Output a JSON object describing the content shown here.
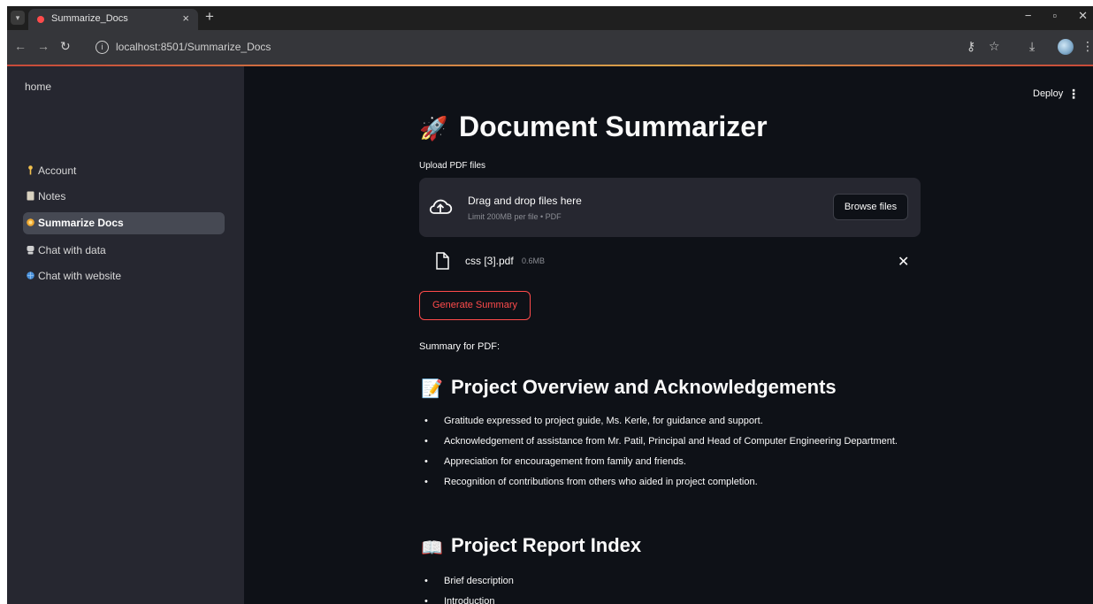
{
  "browser": {
    "tab_title": "Summarize_Docs",
    "url": "localhost:8501/Summarize_Docs"
  },
  "sidebar": {
    "home_label": "home",
    "items": [
      {
        "label": "Account",
        "icon": "key-icon",
        "color": "#f2c14e"
      },
      {
        "label": "Notes",
        "icon": "notebook-icon",
        "color": "#d9d2c0"
      },
      {
        "label": "Summarize Docs",
        "icon": "coin-icon",
        "color": "#f0a830"
      },
      {
        "label": "Chat with data",
        "icon": "chat-icon",
        "color": "#d0d0d0"
      },
      {
        "label": "Chat with website",
        "icon": "globe-icon",
        "color": "#4a90d9"
      }
    ],
    "active_index": 2
  },
  "header": {
    "deploy_label": "Deploy",
    "menu_icon": "⋮"
  },
  "main": {
    "title": "Document Summarizer",
    "title_icon": "🚀",
    "upload_label": "Upload PDF files",
    "dropzone": {
      "title": "Drag and drop files here",
      "limit": "Limit 200MB per file • PDF",
      "browse_label": "Browse files"
    },
    "file": {
      "name": "css [3].pdf",
      "size": "0.6MB"
    },
    "generate_label": "Generate Summary",
    "summary_label": "Summary for PDF:",
    "sections": [
      {
        "icon": "📝",
        "heading": "Project Overview and Acknowledgements",
        "bullets": [
          "Gratitude expressed to project guide, Ms. Kerle, for guidance and support.",
          "Acknowledgement of assistance from Mr. Patil, Principal and Head of Computer Engineering Department.",
          "Appreciation for encouragement from family and friends.",
          "Recognition of contributions from others who aided in project completion."
        ]
      },
      {
        "icon": "📖",
        "heading": "Project Report Index",
        "bullets": [
          "Brief description",
          "Introduction"
        ]
      }
    ]
  },
  "colors": {
    "app_bg": "#0e1117",
    "sidebar_bg": "#262730",
    "accent": "#ff4b4b"
  }
}
